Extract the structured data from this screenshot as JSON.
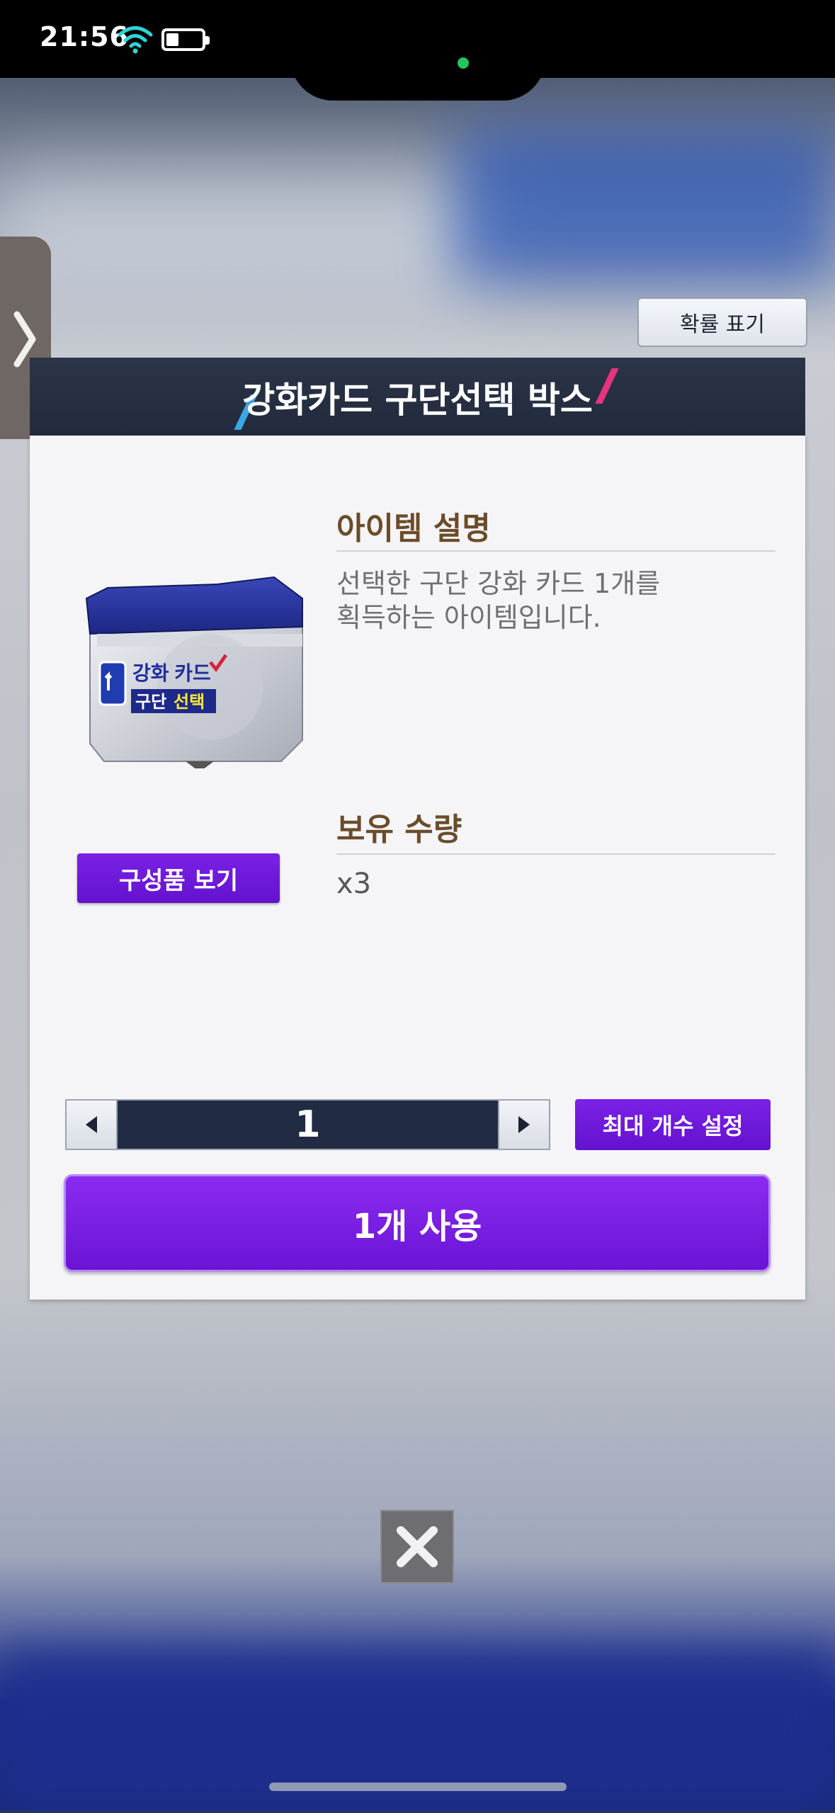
{
  "status_bar": {
    "time": "21:56",
    "battery_level": 0.35
  },
  "side_tab": {
    "icon": "chevron-right-icon"
  },
  "probability_button": {
    "label": "확률 표기"
  },
  "dialog": {
    "title": "강화카드 구단선택 박스",
    "item_image": {
      "icon": "item-box-icon",
      "text_top": "강화 카드",
      "text_bottom_a": "구단",
      "text_bottom_b": "선택"
    },
    "components_button": {
      "label": "구성품 보기"
    },
    "description": {
      "title": "아이템 설명",
      "text": "선택한 구단 강화 카드 1개를\n획득하는 아이템입니다."
    },
    "owned": {
      "title": "보유 수량",
      "value": "x3"
    },
    "stepper": {
      "value": "1",
      "decrement_icon": "triangle-left-icon",
      "increment_icon": "triangle-right-icon"
    },
    "max_button": {
      "label": "최대 개수 설정"
    },
    "use_button": {
      "label": "1개 사용"
    }
  },
  "close_button": {
    "icon": "close-icon"
  },
  "colors": {
    "accent_purple": "#7a21e6",
    "header_dark": "#222a3c",
    "title_brown": "#6b4c2a"
  }
}
